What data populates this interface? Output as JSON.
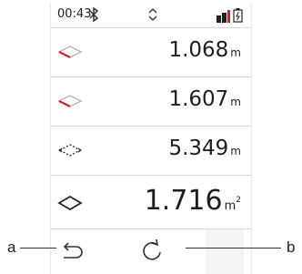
{
  "status": {
    "time": "00:43",
    "icons": [
      "bluetooth-icon",
      "up-down-arrows-icon",
      "signal-bars-icon",
      "battery-icon"
    ],
    "colors": {
      "accent_red": "#cc2233"
    }
  },
  "measurements": [
    {
      "icon": "rhombus-edge-icon",
      "value": "1.068",
      "unit": "m",
      "unit_sup": ""
    },
    {
      "icon": "rhombus-edge-icon",
      "value": "1.607",
      "unit": "m",
      "unit_sup": ""
    },
    {
      "icon": "rhombus-perimeter-icon",
      "value": "5.349",
      "unit": "m",
      "unit_sup": ""
    },
    {
      "icon": "rhombus-area-icon",
      "value": "1.716",
      "unit": "m",
      "unit_sup": "2"
    }
  ],
  "softkeys": {
    "left_icon": "back-arrow-icon",
    "center_icon": "redo-icon"
  },
  "callouts": {
    "left": "a",
    "right": "b"
  }
}
